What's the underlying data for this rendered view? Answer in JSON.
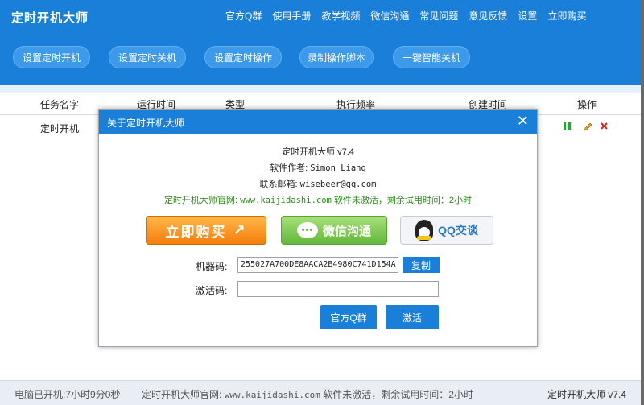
{
  "app": {
    "title": "定时开机大师"
  },
  "top_menu": [
    "官方Q群",
    "使用手册",
    "教学视频",
    "微信沟通",
    "常见问题",
    "意见反馈",
    "设置",
    "立即购买"
  ],
  "toolbar": [
    "设置定时开机",
    "设置定时关机",
    "设置定时操作",
    "录制操作脚本",
    "一键智能关机"
  ],
  "table": {
    "headers": [
      "任务名字",
      "运行时间",
      "类型",
      "执行频率",
      "创建时间",
      "操作"
    ],
    "rows": [
      {
        "name": "定时开机"
      }
    ]
  },
  "about": {
    "title": "关于定时开机大师",
    "version_line": "定时开机大师 v7.4",
    "author_label": "软件作者:",
    "author": "Simon Liang",
    "email_label": "联系邮箱:",
    "email": "wisebeer@qq.com",
    "site_label": "定时开机大师官网:",
    "site": "www.kaijidashi.com",
    "trial_text": "软件未激活，剩余试用时间：2小时",
    "buy_label": "立即购买",
    "wechat_label": "微信沟通",
    "qq_label": "QQ交谈",
    "machine_code_label": "机器码:",
    "machine_code": "255027A700DE8AACA2B4980C741D154A",
    "copy_label": "复制",
    "activation_label": "激活码:",
    "activation_value": "",
    "qq_group_label": "官方Q群",
    "activate_label": "激活"
  },
  "status": {
    "boot_label": "电脑已开机:",
    "boot_time": "7小时9分0秒",
    "site_label": "定时开机大师官网:",
    "site": "www.kaijidashi.com",
    "trial_text": "软件未激活，剩余试用时间：2小时",
    "version": "定时开机大师 v7.4"
  },
  "colors": {
    "primary": "#1a7fd9",
    "green_text": "#2b8a1a",
    "buy_orange": "#f47d0b",
    "wechat_green": "#63b83a"
  },
  "icons": [
    "pause-icon",
    "edit-pencil-icon",
    "delete-x-icon",
    "close-icon",
    "wechat-icon",
    "qq-penguin-icon"
  ]
}
